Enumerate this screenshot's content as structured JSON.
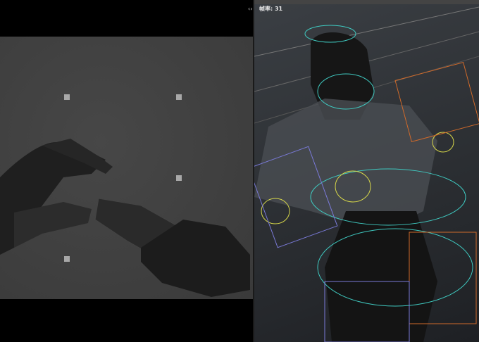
{
  "viewport_right": {
    "fps_label": "帧率: 31"
  },
  "colors": {
    "rig_cyan": "#3fc9c0",
    "rig_yellow": "#d8d84a",
    "rig_orange": "#d06a2a",
    "rig_purple": "#7a7ad8"
  }
}
